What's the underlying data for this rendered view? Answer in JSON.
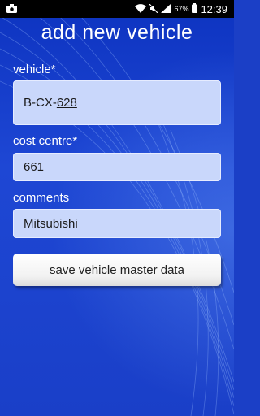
{
  "status_bar": {
    "battery_percent": "67%",
    "time": "12:39",
    "icons": [
      "camera-icon",
      "wifi-icon",
      "mute-icon",
      "signal-icon",
      "battery-icon"
    ]
  },
  "screen": {
    "title": "add new vehicle"
  },
  "form": {
    "vehicle": {
      "label": "vehicle*",
      "value_prefix": "B-CX-",
      "value_suffix": "628"
    },
    "cost_centre": {
      "label": "cost centre*",
      "value": "661"
    },
    "comments": {
      "label": "comments",
      "value": "Mitsubishi"
    },
    "save_label": "save vehicle master data"
  },
  "colors": {
    "background": "#1b3fc6",
    "field_fill": "#c9d7fb"
  }
}
